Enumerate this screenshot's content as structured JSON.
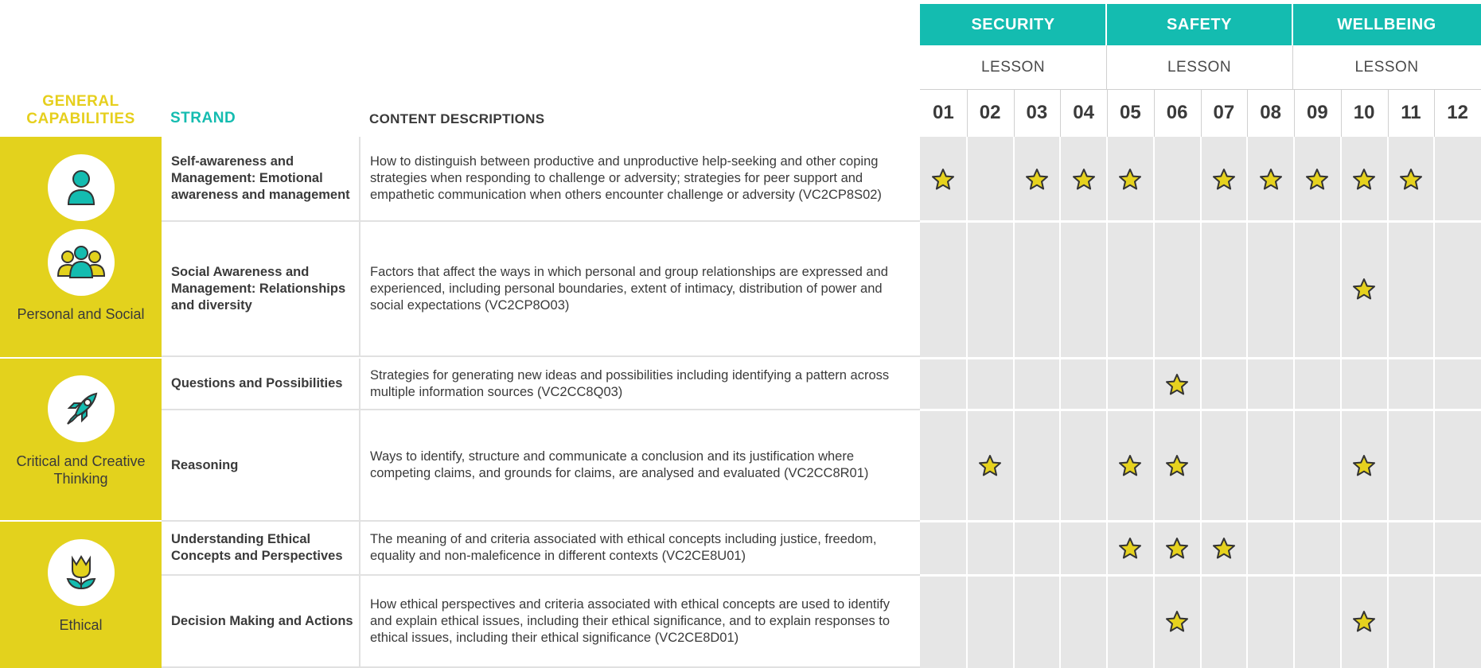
{
  "header": {
    "general_capabilities": "GENERAL CAPABILITIES",
    "strand": "STRAND",
    "content_descriptions": "CONTENT DESCRIPTIONS"
  },
  "themes": [
    {
      "label": "SECURITY",
      "lesson_label": "LESSON"
    },
    {
      "label": "SAFETY",
      "lesson_label": "LESSON"
    },
    {
      "label": "WELLBEING",
      "lesson_label": "LESSON"
    }
  ],
  "lessons": [
    "01",
    "02",
    "03",
    "04",
    "05",
    "06",
    "07",
    "08",
    "09",
    "10",
    "11",
    "12"
  ],
  "capabilities": [
    {
      "label": "Personal and Social",
      "icon": "person-icon"
    },
    {
      "label": "Critical and Creative Thinking",
      "icon": "rocket-icon"
    },
    {
      "label": "Ethical",
      "icon": "tulip-icon"
    }
  ],
  "rows": [
    {
      "strand": "Self-awareness and Management: Emotional awareness and management",
      "content": "How to distinguish between productive and unproductive help-seeking and other coping strategies when responding to challenge or adversity; strategies for peer support and empathetic communication when others encounter challenge or adversity (VC2CP8S02)",
      "stars": [
        "01",
        "03",
        "04",
        "05",
        "07",
        "08",
        "09",
        "10",
        "11"
      ]
    },
    {
      "strand": "Social Awareness and Management: Relationships and diversity",
      "content": "Factors that affect the ways in which personal and group relationships are expressed and experienced, including personal boundaries, extent of intimacy, distribution of power and social expectations (VC2CP8O03)",
      "stars": [
        "10"
      ]
    },
    {
      "strand": "Questions and Possibilities",
      "content": "Strategies for generating new ideas and possibilities including identifying a pattern across multiple information sources (VC2CC8Q03)",
      "stars": [
        "06"
      ]
    },
    {
      "strand": "Reasoning",
      "content": "Ways to identify, structure and communicate a conclusion and its justification where competing claims, and grounds for claims, are analysed and evaluated (VC2CC8R01)",
      "stars": [
        "02",
        "05",
        "06",
        "10"
      ]
    },
    {
      "strand": "Understanding Ethical Concepts and Perspectives",
      "content": "The meaning of and criteria associated with ethical concepts including justice, freedom, equality and non-maleficence in different contexts (VC2CE8U01)",
      "stars": [
        "05",
        "06",
        "07"
      ]
    },
    {
      "strand": "Decision Making and Actions",
      "content": "How ethical perspectives and criteria associated with ethical concepts are used to identify and explain ethical issues, including their ethical significance, and to explain responses to ethical issues, including their ethical significance (VC2CE8D01)",
      "stars": [
        "06",
        "10"
      ]
    }
  ],
  "colors": {
    "teal": "#14bcb0",
    "yellow": "#e3d21d",
    "star": "#e6d21e",
    "grid": "#e6e6e6"
  }
}
